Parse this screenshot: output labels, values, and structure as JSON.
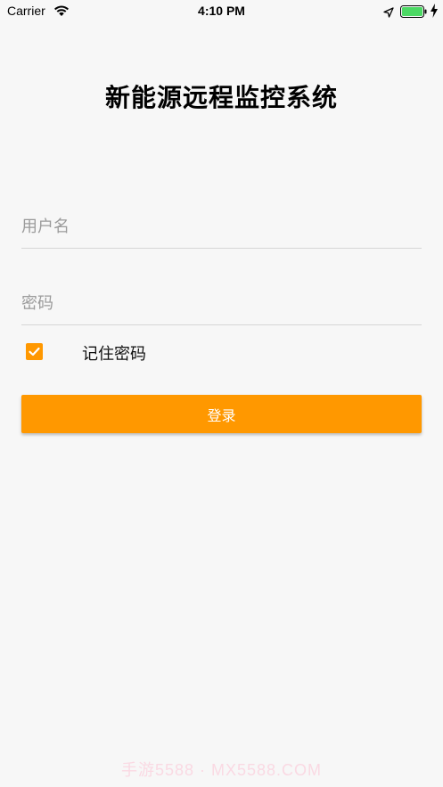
{
  "status_bar": {
    "carrier": "Carrier",
    "time": "4:10 PM",
    "battery_color": "#4cd964"
  },
  "login": {
    "title": "新能源远程监控系统",
    "username_placeholder": "用户名",
    "password_placeholder": "密码",
    "remember_label": "记住密码",
    "remember_checked": true,
    "login_button_label": "登录"
  },
  "watermark": {
    "text": "手游5588 · MX5588.COM"
  },
  "colors": {
    "accent": "#ff9800",
    "background": "#f7f7f7",
    "divider": "#d6d6d6"
  },
  "icons": {
    "wifi": "wifi-icon",
    "location": "location-arrow-icon",
    "battery": "battery-icon",
    "charging": "charging-bolt-icon",
    "check": "checkmark-icon"
  }
}
